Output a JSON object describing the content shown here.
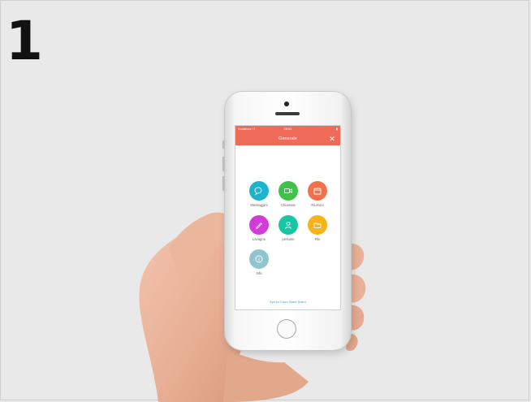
{
  "step_number": "1",
  "status_bar": {
    "carrier": "Vodafone IT",
    "time": "09:54",
    "battery": ""
  },
  "header": {
    "title": "Generale",
    "close_icon": "close-icon"
  },
  "menu": [
    {
      "label": "Messaggini",
      "icon": "chat-bubble-icon",
      "color": "#1fb2cc"
    },
    {
      "label": "Chiamate",
      "icon": "video-camera-icon",
      "color": "#3ec24a"
    },
    {
      "label": "Riunioni",
      "icon": "calendar-icon",
      "color": "#f2714d"
    },
    {
      "label": "Lavagne",
      "icon": "pencil-icon",
      "color": "#d13bd8"
    },
    {
      "label": "persone",
      "icon": "person-icon",
      "color": "#19c6a3"
    },
    {
      "label": "File",
      "icon": "folder-icon",
      "color": "#f7b318"
    },
    {
      "label": "Info",
      "icon": "info-icon",
      "color": "#8fc5cc"
    }
  ],
  "footer": {
    "link": "Apri su Cisco Spark Board",
    "sub": ""
  },
  "colors": {
    "accent": "#ef6b57",
    "background": "#e9e9e9"
  }
}
